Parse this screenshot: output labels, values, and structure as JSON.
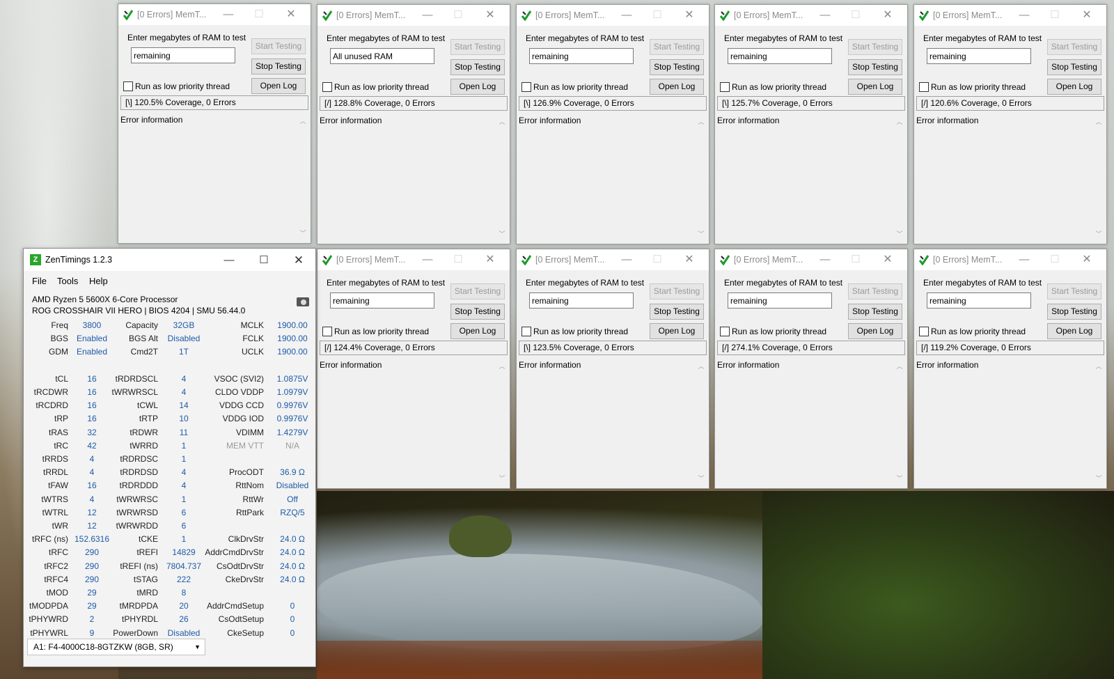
{
  "memtest": {
    "title": "[0 Errors] MemT...",
    "prompt": "Enter megabytes of RAM to test",
    "start_label": "Start Testing",
    "stop_label": "Stop Testing",
    "log_label": "Open Log",
    "low_priority_label": "Run as low priority thread",
    "error_info_label": "Error information",
    "windows": [
      {
        "ram_value": "remaining",
        "status": "[\\]   120.5% Coverage, 0 Errors"
      },
      {
        "ram_value": "All unused RAM",
        "status": "[/]   128.8% Coverage, 0 Errors"
      },
      {
        "ram_value": "remaining",
        "status": "[\\]   126.9% Coverage, 0 Errors"
      },
      {
        "ram_value": "remaining",
        "status": "[\\]   125.7% Coverage, 0 Errors"
      },
      {
        "ram_value": "remaining",
        "status": "[/]   120.6% Coverage, 0 Errors"
      },
      {
        "ram_value": "remaining",
        "status": "[/]   124.4% Coverage, 0 Errors"
      },
      {
        "ram_value": "remaining",
        "status": "[\\]   123.5% Coverage, 0 Errors"
      },
      {
        "ram_value": "remaining",
        "status": "[/]   274.1% Coverage, 0 Errors"
      },
      {
        "ram_value": "remaining",
        "status": "[/]   119.2% Coverage, 0 Errors"
      }
    ]
  },
  "zen": {
    "title": "ZenTimings 1.2.3",
    "icon_letter": "Z",
    "menu": [
      "File",
      "Tools",
      "Help"
    ],
    "cpu": "AMD Ryzen 5 5600X 6-Core Processor",
    "board": "ROG CROSSHAIR VII HERO | BIOS 4204 | SMU 56.44.0",
    "col1": [
      [
        "Freq",
        "3800"
      ],
      [
        "BGS",
        "Enabled"
      ],
      [
        "GDM",
        "Enabled"
      ],
      [
        "",
        ""
      ],
      [
        "tCL",
        "16"
      ],
      [
        "tRCDWR",
        "16"
      ],
      [
        "tRCDRD",
        "16"
      ],
      [
        "tRP",
        "16"
      ],
      [
        "tRAS",
        "32"
      ],
      [
        "tRC",
        "42"
      ],
      [
        "tRRDS",
        "4"
      ],
      [
        "tRRDL",
        "4"
      ],
      [
        "tFAW",
        "16"
      ],
      [
        "tWTRS",
        "4"
      ],
      [
        "tWTRL",
        "12"
      ],
      [
        "tWR",
        "12"
      ],
      [
        "tRFC (ns)",
        "152.6316"
      ],
      [
        "tRFC",
        "290"
      ],
      [
        "tRFC2",
        "290"
      ],
      [
        "tRFC4",
        "290"
      ],
      [
        "tMOD",
        "29"
      ],
      [
        "tMODPDA",
        "29"
      ],
      [
        "tPHYWRD",
        "2"
      ],
      [
        "tPHYWRL",
        "9"
      ]
    ],
    "col2": [
      [
        "Capacity",
        "32GB"
      ],
      [
        "BGS Alt",
        "Disabled"
      ],
      [
        "Cmd2T",
        "1T"
      ],
      [
        "",
        ""
      ],
      [
        "tRDRDSCL",
        "4"
      ],
      [
        "tWRWRSCL",
        "4"
      ],
      [
        "tCWL",
        "14"
      ],
      [
        "tRTP",
        "10"
      ],
      [
        "tRDWR",
        "11"
      ],
      [
        "tWRRD",
        "1"
      ],
      [
        "tRDRDSC",
        "1"
      ],
      [
        "tRDRDSD",
        "4"
      ],
      [
        "tRDRDDD",
        "4"
      ],
      [
        "tWRWRSC",
        "1"
      ],
      [
        "tWRWRSD",
        "6"
      ],
      [
        "tWRWRDD",
        "6"
      ],
      [
        "tCKE",
        "1"
      ],
      [
        "tREFI",
        "14829"
      ],
      [
        "tREFI (ns)",
        "7804.737"
      ],
      [
        "tSTAG",
        "222"
      ],
      [
        "tMRD",
        "8"
      ],
      [
        "tMRDPDA",
        "20"
      ],
      [
        "tPHYRDL",
        "26"
      ],
      [
        "PowerDown",
        "Disabled"
      ]
    ],
    "col3": [
      [
        "MCLK",
        "1900.00"
      ],
      [
        "FCLK",
        "1900.00"
      ],
      [
        "UCLK",
        "1900.00"
      ],
      [
        "",
        ""
      ],
      [
        "VSOC (SVI2)",
        "1.0875V"
      ],
      [
        "CLDO VDDP",
        "1.0979V"
      ],
      [
        "VDDG CCD",
        "0.9976V"
      ],
      [
        "VDDG IOD",
        "0.9976V"
      ],
      [
        "VDIMM",
        "1.4279V"
      ],
      [
        "MEM VTT",
        "N/A"
      ],
      [
        "",
        ""
      ],
      [
        "ProcODT",
        "36.9 Ω"
      ],
      [
        "RttNom",
        "Disabled"
      ],
      [
        "RttWr",
        "Off"
      ],
      [
        "RttPark",
        "RZQ/5"
      ],
      [
        "",
        ""
      ],
      [
        "ClkDrvStr",
        "24.0 Ω"
      ],
      [
        "AddrCmdDrvStr",
        "24.0 Ω"
      ],
      [
        "CsOdtDrvStr",
        "24.0 Ω"
      ],
      [
        "CkeDrvStr",
        "24.0 Ω"
      ],
      [
        "",
        ""
      ],
      [
        "AddrCmdSetup",
        "0"
      ],
      [
        "CsOdtSetup",
        "0"
      ],
      [
        "CkeSetup",
        "0"
      ]
    ],
    "dimm_selected": "A1: F4-4000C18-8GTZKW (8GB, SR)"
  }
}
